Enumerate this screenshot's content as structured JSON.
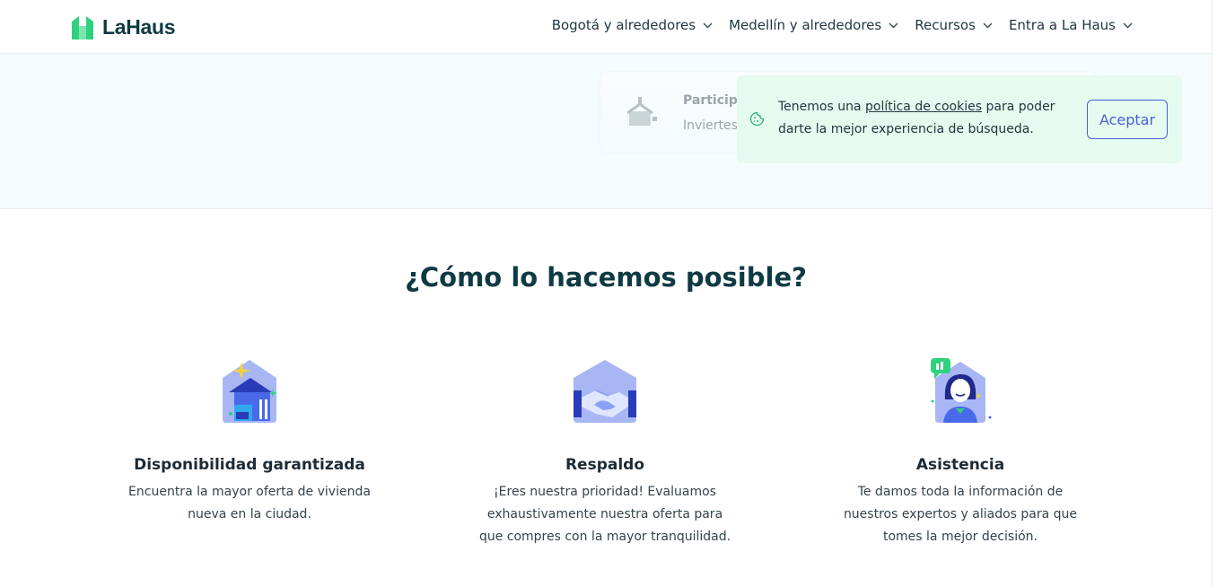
{
  "header": {
    "logo_text": "LaHaus",
    "nav": [
      {
        "label": "Bogotá y alrededores"
      },
      {
        "label": "Medellín y alrededores"
      },
      {
        "label": "Recursos"
      },
      {
        "label": "Entra a La Haus"
      }
    ]
  },
  "background_card": {
    "title": "Participa",
    "text": "Inviertes"
  },
  "cookie_banner": {
    "text_before": "Tenemos una ",
    "link": "política de cookies",
    "text_after": " para poder darte la mejor experiencia de búsqueda.",
    "accept_label": "Aceptar"
  },
  "section": {
    "title": "¿Cómo lo hacemos posible?",
    "features": [
      {
        "title": "Disponibilidad garantizada",
        "desc_lines": [
          "Encuentra la mayor oferta de vivienda",
          "nueva en la ciudad."
        ],
        "icon": "house-sparkle-illustration"
      },
      {
        "title": "Respaldo",
        "desc_lines": [
          "¡Eres nuestra prioridad! Evaluamos",
          "exhaustivamente nuestra oferta para",
          "que compres con la mayor tranquilidad."
        ],
        "icon": "handshake-illustration"
      },
      {
        "title": "Asistencia",
        "desc_lines": [
          "Te damos toda la información de",
          "nuestros expertos y aliados para que",
          "tomes la mejor decisión."
        ],
        "icon": "assistant-illustration"
      }
    ]
  },
  "colors": {
    "brand_green": "#2fd17f",
    "brand_dark": "#0e3b43",
    "accent_blue": "#4b60d8",
    "cookie_bg": "#e6fbef",
    "band_bg": "#f5fcfd"
  }
}
